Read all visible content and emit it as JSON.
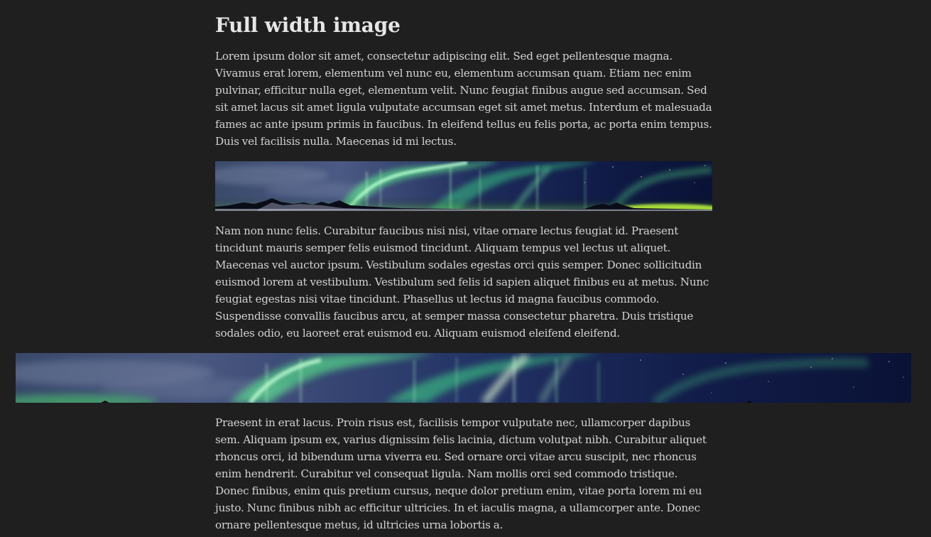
{
  "article": {
    "title": "Full width image",
    "paragraphs": [
      "Lorem ipsum dolor sit amet, consectetur adipiscing elit. Sed eget pellentesque magna. Vivamus erat lorem, elementum vel nunc eu, elementum accumsan quam. Etiam nec enim pulvinar, efficitur nulla eget, elementum velit. Nunc feugiat finibus augue sed accumsan. Sed sit amet lacus sit amet ligula vulputate accumsan eget sit amet metus. Interdum et malesuada fames ac ante ipsum primis in faucibus. In eleifend tellus eu felis porta, ac porta enim tempus. Duis vel facilisis nulla. Maecenas id mi lectus.",
      "Nam non nunc felis. Curabitur faucibus nisi nisi, vitae ornare lectus feugiat id. Praesent tincidunt mauris semper felis euismod tincidunt. Aliquam tempus vel lectus ut aliquet. Maecenas vel auctor ipsum. Vestibulum sodales egestas orci quis semper. Donec sollicitudin euismod lorem at vestibulum. Vestibulum sed felis id sapien aliquet finibus eu at metus. Nunc feugiat egestas nisi vitae tincidunt. Phasellus ut lectus id magna faucibus commodo. Suspendisse convallis faucibus arcu, at semper massa consectetur pharetra. Duis tristique sodales odio, eu laoreet erat euismod eu. Aliquam euismod eleifend eleifend.",
      "Praesent in erat lacus. Proin risus est, facilisis tempor vulputate nec, ullamcorper dapibus sem. Aliquam ipsum ex, varius dignissim felis lacinia, dictum volutpat nibh. Curabitur aliquet rhoncus orci, id bibendum urna viverra eu. Sed ornare orci vitae arcu suscipit, nec rhoncus enim hendrerit. Curabitur vel consequat ligula. Nam mollis orci sed commodo tristique. Donec finibus, enim quis pretium cursus, neque dolor pretium enim, vitae porta lorem mi eu justo. Nunc finibus nibh ac efficitur ultricies. In et iaculis magna, a ullamcorper ante. Donec ornare pellentesque metus, id ultricies urna lobortis a."
    ],
    "images": [
      {
        "subject": "aurora-borealis-panorama",
        "width_mode": "content"
      },
      {
        "subject": "aurora-borealis-panorama",
        "width_mode": "full"
      }
    ]
  },
  "colors": {
    "background": "#1f1f1f",
    "text": "#d2d2d2",
    "heading": "#e6e6e6",
    "aurora_green": "#6bff9a",
    "night_sky": "#0c1430"
  }
}
